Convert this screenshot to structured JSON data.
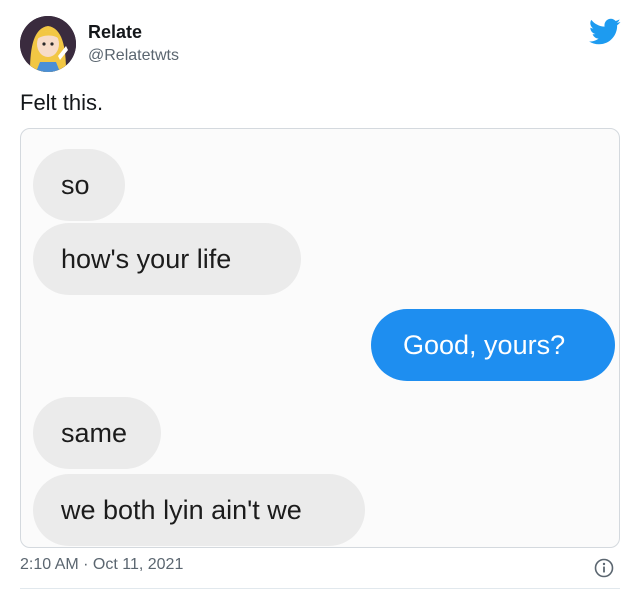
{
  "author": {
    "name": "Relate",
    "handle": "@Relatetwts",
    "avatar_icon": "cartoon-girl-avatar"
  },
  "brand": {
    "icon": "twitter-bird-icon",
    "color": "#1d9bf0"
  },
  "tweet": {
    "text": "Felt this.",
    "timestamp": "2:10 AM · Oct 11, 2021"
  },
  "media": {
    "messages": [
      {
        "side": "received",
        "text": "so"
      },
      {
        "side": "received",
        "text": "how's your life"
      },
      {
        "side": "sent",
        "text": "Good, yours?"
      },
      {
        "side": "received",
        "text": "same"
      },
      {
        "side": "received",
        "text": "we both lyin ain't we"
      }
    ],
    "received_bubble_color": "#ebebeb",
    "sent_bubble_color": "#1e8ef0"
  },
  "footer": {
    "info_icon": "info-icon"
  }
}
